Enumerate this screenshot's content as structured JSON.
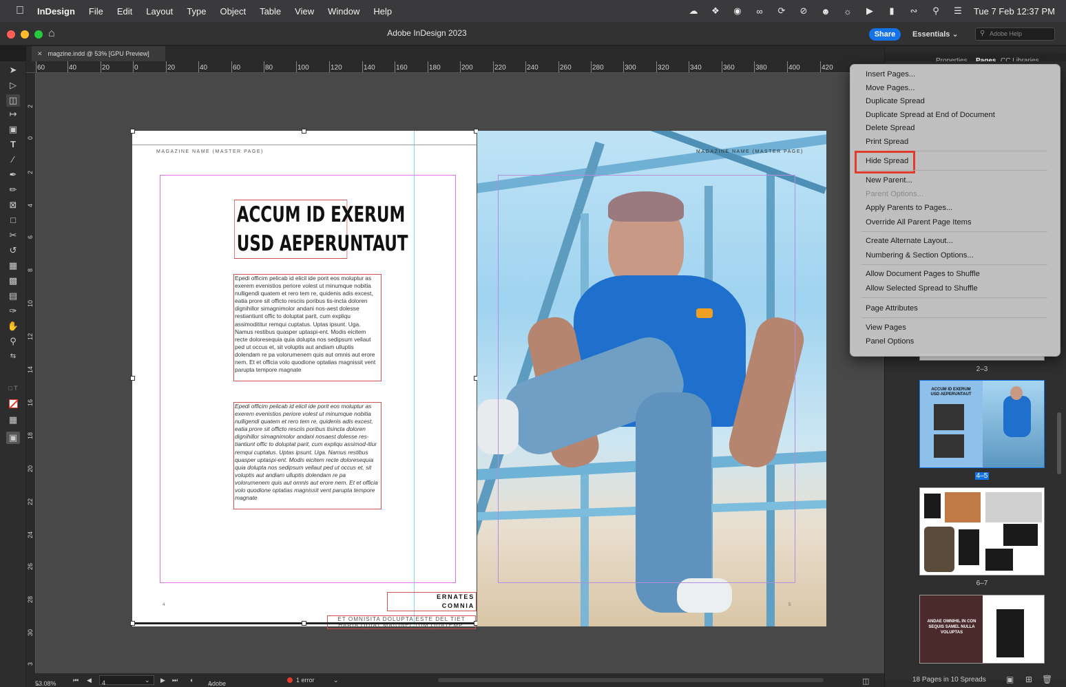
{
  "menubar": {
    "app": "InDesign",
    "items": [
      "File",
      "Edit",
      "Layout",
      "Type",
      "Object",
      "Table",
      "View",
      "Window",
      "Help"
    ],
    "clock": "Tue 7 Feb  12:37 PM"
  },
  "titlebar": {
    "title": "Adobe InDesign 2023",
    "share": "Share",
    "workspace": "Essentials",
    "help_placeholder": "Adobe Help"
  },
  "document_tab": {
    "label": "magzine.indd @ 53% [GPU Preview]"
  },
  "ruler_h": [
    "60",
    "40",
    "20",
    "0",
    "20",
    "40",
    "60",
    "80",
    "100",
    "120",
    "140",
    "160",
    "180",
    "200",
    "220",
    "240",
    "260",
    "280",
    "300",
    "320",
    "340",
    "360",
    "380",
    "400",
    "420"
  ],
  "ruler_v": [
    "2",
    "0",
    "2",
    "4",
    "6",
    "8",
    "10",
    "12",
    "14",
    "16",
    "18",
    "20",
    "22",
    "24",
    "26",
    "28",
    "30",
    "3"
  ],
  "spread": {
    "left_header": "MAGAZINE NAME (MASTER PAGE)",
    "right_header": "MAGAZINE NAME (MASTER PAGE)",
    "headline_line1": "ACCUM ID EXERUM",
    "headline_line2": "USD AEPERUNTAUT",
    "body1": "Epedi officim pelicab id elicil ide porit eos moluptur as exerem evenistios periore volest ut minumque nobitia nulligendi quatem et rero tem re, quidenis adis excest, eatia prore sit officto resciis poribus tis-incta doloren dignihillor simagnimolor andani nos-aest dolesse restiantiunt offic to doluptat parit, cum expliqu assimodititur remqui cuptatus. Uptas ipsunt. Uga. Namus restibus quasper uptaspi-ent. Modis eicitem recte doloresequia quia dolupta nos sedipsum vellaut ped ut occus et, sit voluptis aut andiam ulluptis dolendam re pa volorumenem quis aut omnis aut erore nem. Et et officia volo quodione optatias magnissit vent parupta tempore magnate",
    "body2": "Epedi officim pelicab id elicil ide porit eos moluptur as exerem evenistios periore volest ut minumque nobitia nulligendi quatem et rero tem re, quidenis adis excest, eatia prore sit officto resciis poribus tisincta doloren dignihillor simagnimolor andani nosaest dolesse res-tiantiunt offic to doluptat parit, cum expliqu assimod-itiur remqui cuptatus. Uptas ipsunt. Uga. Namus restibus quasper uptaspi-ent. Modis eicitem recte doloresequia quia dolupta nos sedipsum vellaut ped ut occus et, sit voluptis aut andiam ulluptis dolendam re pa volorumenem quis aut omnis aut erore nem. Et et officia volo quodione optatias magnissit vent parupta tempore magnate",
    "byline1": "ERNATES",
    "byline2": "COMNIA",
    "tagline1": "ET OMNISITA DOLUPTA ESTE DEL TIET",
    "tagline2": "HARIA QUIAT MAIONECTUM QUATEMP.",
    "folio_left": "4",
    "folio_right": "5"
  },
  "panels": {
    "tab_properties": "Properties",
    "tab_pages": "Pages",
    "tab_cc": "CC Libraries",
    "spread_labels": [
      "2–3",
      "4–5",
      "6–7"
    ],
    "thumb_headline": "ACCUM ID EXERUM USD AEPERUNTAUT",
    "thumb3_text": "ANDAE OMNIHIL IN CON SEQUIS SAMEL NULLA VOLUPTAS",
    "pages_count": "18 Pages in 10 Spreads"
  },
  "flyout_menu": {
    "items": [
      "Insert Pages...",
      "Move Pages...",
      "Duplicate Spread",
      "Duplicate Spread at End of Document",
      "Delete Spread",
      "Print Spread",
      "Hide Spread",
      "New Parent...",
      "Parent Options...",
      "Apply Parents to Pages...",
      "Override All Parent Page Items",
      "Create Alternate Layout...",
      "Numbering & Section Options...",
      "Allow Document Pages to Shuffle",
      "Allow Selected Spread to Shuffle",
      "Page Attributes",
      "View Pages",
      "Panel Options"
    ],
    "highlighted": "Hide Spread",
    "disabled": "Parent Options..."
  },
  "statusbar": {
    "zoom": "53.08%",
    "page": "4",
    "preflight_profile": "Adobe Templates...",
    "errors": "1 error"
  },
  "colors": {
    "accent": "#1473e6",
    "highlight_border": "#e23b2e",
    "margin_guide": "#e070e0",
    "frame_edge": "#d05050"
  }
}
